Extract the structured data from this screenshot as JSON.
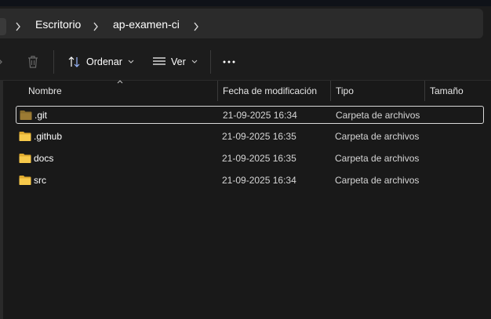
{
  "address_bar": {
    "crumbs": [
      "Escritorio",
      "ap-examen-ci"
    ]
  },
  "toolbar": {
    "sort_label": "Ordenar",
    "view_label": "Ver",
    "more_label": "···"
  },
  "columns": {
    "name": "Nombre",
    "modified": "Fecha de modificación",
    "type": "Tipo",
    "size": "Tamaño"
  },
  "files": [
    {
      "name": ".git",
      "modified": "21-09-2025 16:34",
      "type": "Carpeta de archivos",
      "size": "",
      "selected": true,
      "icon": "folder-dimmed-icon"
    },
    {
      "name": ".github",
      "modified": "21-09-2025 16:35",
      "type": "Carpeta de archivos",
      "size": "",
      "selected": false,
      "icon": "folder-icon"
    },
    {
      "name": "docs",
      "modified": "21-09-2025 16:35",
      "type": "Carpeta de archivos",
      "size": "",
      "selected": false,
      "icon": "folder-icon"
    },
    {
      "name": "src",
      "modified": "21-09-2025 16:34",
      "type": "Carpeta de archivos",
      "size": "",
      "selected": false,
      "icon": "folder-icon"
    }
  ],
  "colors": {
    "background": "#191919",
    "folder": "#f4c542",
    "folder_dimmed": "#8a6d2c",
    "selection_border": "#d9d9d9"
  }
}
